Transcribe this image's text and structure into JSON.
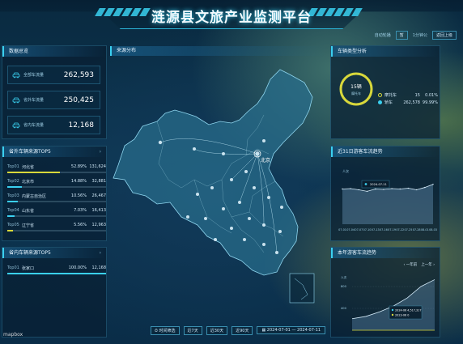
{
  "header": {
    "title": "涟源县文旅产业监测平台",
    "auto_play_label": "自动轮播",
    "auto_play_state": "暂",
    "refresh_label": "1分钟公",
    "back_label": "返回上级"
  },
  "overview": {
    "title": "数据总览",
    "stats": [
      {
        "label": "全部车流量",
        "value": "262,593",
        "icon": "car-icon"
      },
      {
        "label": "省外车流量",
        "value": "250,425",
        "icon": "car-icon"
      },
      {
        "label": "省内车流量",
        "value": "12,168",
        "icon": "car-icon"
      }
    ]
  },
  "outside_top5": {
    "title": "省外车辆来源TOP5",
    "items": [
      {
        "rank": "Top01",
        "name": "河北省",
        "pct": "52.89%",
        "count": "131,624",
        "fraction": 0.53,
        "color": "#d8d83a"
      },
      {
        "rank": "Top02",
        "name": "北京市",
        "pct": "14.88%",
        "count": "32,881",
        "fraction": 0.15,
        "color": "#3ad0f0"
      },
      {
        "rank": "Top03",
        "name": "内蒙古自治区",
        "pct": "10.56%",
        "count": "26,467",
        "fraction": 0.11,
        "color": "#3ad0f0"
      },
      {
        "rank": "Top04",
        "name": "山东省",
        "pct": "7.03%",
        "count": "16,413",
        "fraction": 0.07,
        "color": "#3ad0f0"
      },
      {
        "rank": "Top05",
        "name": "辽宁省",
        "pct": "5.56%",
        "count": "12,963",
        "fraction": 0.06,
        "color": "#d8d83a"
      }
    ]
  },
  "inside_top5": {
    "title": "省内车辆来源TOP5",
    "items": [
      {
        "rank": "Top01",
        "name": "张家口",
        "pct": "100.00%",
        "count": "12,168",
        "fraction": 1.0,
        "color": "#3ad0f0"
      }
    ]
  },
  "map": {
    "title": "来源分布",
    "beijing_label": "北京",
    "time_select_label": "时间筛选",
    "chips": [
      "近7天",
      "近30天",
      "近90天"
    ],
    "date_start": "2024-07-01",
    "date_sep": "—",
    "date_end": "2024-07-11",
    "attribution": "mapbox"
  },
  "vehicle_type": {
    "title": "车辆类型分析",
    "center_value": "15辆",
    "center_label": "摩托车",
    "legend": [
      {
        "name": "摩托车",
        "count": "15",
        "pct": "0.01%",
        "color": "#d8d83a"
      },
      {
        "name": "轿车",
        "count": "262,578",
        "pct": "99.99%",
        "color": "#3ad0f0"
      }
    ],
    "fraction": 0.9999
  },
  "trend31": {
    "title": "近31日游客车流趋势",
    "unit": "人次",
    "tooltip_date": "2024-07-11",
    "chart_data": {
      "type": "area",
      "x": [
        "07-01",
        "07-04",
        "07-07",
        "07-10",
        "07-13",
        "07-16",
        "07-19",
        "07-22",
        "07-25",
        "07-28",
        "07-31",
        "08-03"
      ],
      "values": [
        9000,
        9100,
        8800,
        8400,
        9000,
        8900,
        9100,
        9000,
        9200,
        8800,
        9400,
        10200
      ],
      "ylim": [
        0,
        12000
      ],
      "x_labels": [
        "07-01",
        "07-04",
        "07-07",
        "07-10",
        "07-13",
        "07-16",
        "07-19",
        "07-22",
        "07-25",
        "07-28",
        "08-01",
        "08-03"
      ]
    }
  },
  "trend_year": {
    "title": "本年游客车流趋势",
    "nav_prev": "上一年",
    "nav_next": "一年前",
    "unit": "人次",
    "y_tick": "800",
    "y_tick_low": "400",
    "tooltip_a": "2024-06 4,517,317",
    "tooltip_b": "2023-06 0",
    "chart_data": {
      "type": "line",
      "x": [
        "1",
        "2",
        "3",
        "4",
        "5",
        "6",
        "7"
      ],
      "series": [
        {
          "values": [
            200,
            240,
            320,
            420,
            560,
            760,
            880
          ]
        },
        {
          "values": [
            0,
            0,
            0,
            0,
            0,
            0,
            0
          ]
        }
      ],
      "ylim": [
        0,
        900
      ]
    }
  }
}
